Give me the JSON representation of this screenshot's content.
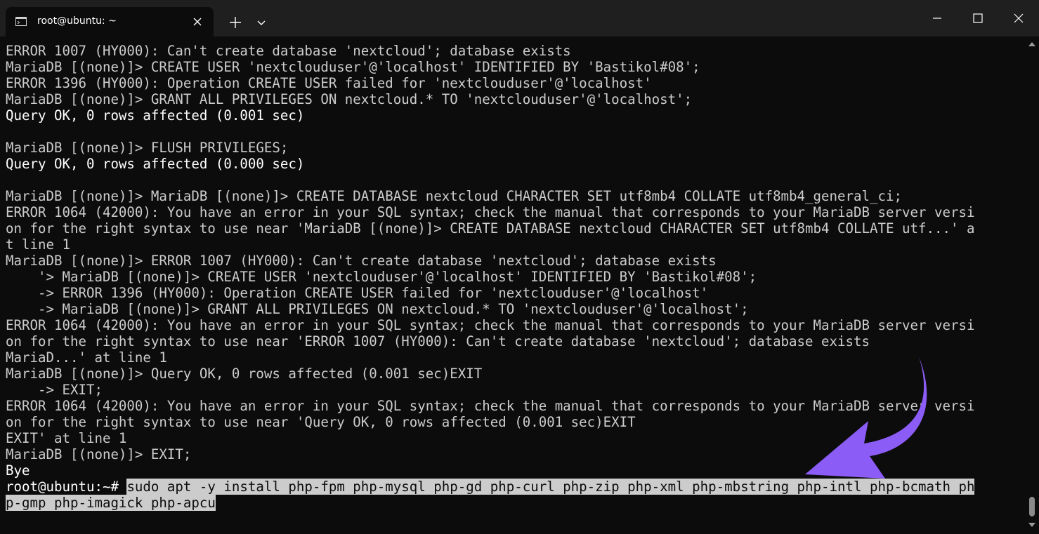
{
  "window": {
    "tab_title": "root@ubuntu: ~",
    "icons": [
      "terminal-icon",
      "close-icon",
      "plus-icon",
      "chevron-down-icon",
      "minimize-icon",
      "maximize-icon",
      "close-icon"
    ]
  },
  "terminal": {
    "lines": [
      "ERROR 1007 (HY000): Can't create database 'nextcloud'; database exists",
      "MariaDB [(none)]> CREATE USER 'nextclouduser'@'localhost' IDENTIFIED BY 'Bastikol#08';",
      "ERROR 1396 (HY000): Operation CREATE USER failed for 'nextclouduser'@'localhost'",
      "MariaDB [(none)]> GRANT ALL PRIVILEGES ON nextcloud.* TO 'nextclouduser'@'localhost';",
      "Query OK, 0 rows affected (0.001 sec)",
      "",
      "MariaDB [(none)]> FLUSH PRIVILEGES;",
      "Query OK, 0 rows affected (0.000 sec)",
      "",
      "MariaDB [(none)]> MariaDB [(none)]> CREATE DATABASE nextcloud CHARACTER SET utf8mb4 COLLATE utf8mb4_general_ci;",
      "ERROR 1064 (42000): You have an error in your SQL syntax; check the manual that corresponds to your MariaDB server versi",
      "on for the right syntax to use near 'MariaDB [(none)]> CREATE DATABASE nextcloud CHARACTER SET utf8mb4 COLLATE utf...' a",
      "t line 1",
      "MariaDB [(none)]> ERROR 1007 (HY000): Can't create database 'nextcloud'; database exists",
      "    '> MariaDB [(none)]> CREATE USER 'nextclouduser'@'localhost' IDENTIFIED BY 'Bastikol#08';",
      "    -> ERROR 1396 (HY000): Operation CREATE USER failed for 'nextclouduser'@'localhost'",
      "    -> MariaDB [(none)]> GRANT ALL PRIVILEGES ON nextcloud.* TO 'nextclouduser'@'localhost';",
      "ERROR 1064 (42000): You have an error in your SQL syntax; check the manual that corresponds to your MariaDB server versi",
      "on for the right syntax to use near 'ERROR 1007 (HY000): Can't create database 'nextcloud'; database exists",
      "MariaD...' at line 1",
      "MariaDB [(none)]> Query OK, 0 rows affected (0.001 sec)EXIT",
      "    -> EXIT;",
      "ERROR 1064 (42000): You have an error in your SQL syntax; check the manual that corresponds to your MariaDB server versi",
      "on for the right syntax to use near 'Query OK, 0 rows affected (0.001 sec)EXIT",
      "EXIT' at line 1",
      "MariaDB [(none)]> EXIT;",
      "Bye"
    ],
    "prompt": "root@ubuntu:~# ",
    "command_line_1": "sudo apt -y install php-fpm php-mysql php-gd php-curl php-zip php-xml php-mbstring php-intl php-bcmath ph",
    "command_line_2": "p-gmp php-imagick php-apcu"
  },
  "colors": {
    "background": "#0c0c0c",
    "text": "#cccccc",
    "selection": "#cccccc",
    "titlebar": "#1f1f1f",
    "annotation_arrow": "#8b5cf6"
  }
}
